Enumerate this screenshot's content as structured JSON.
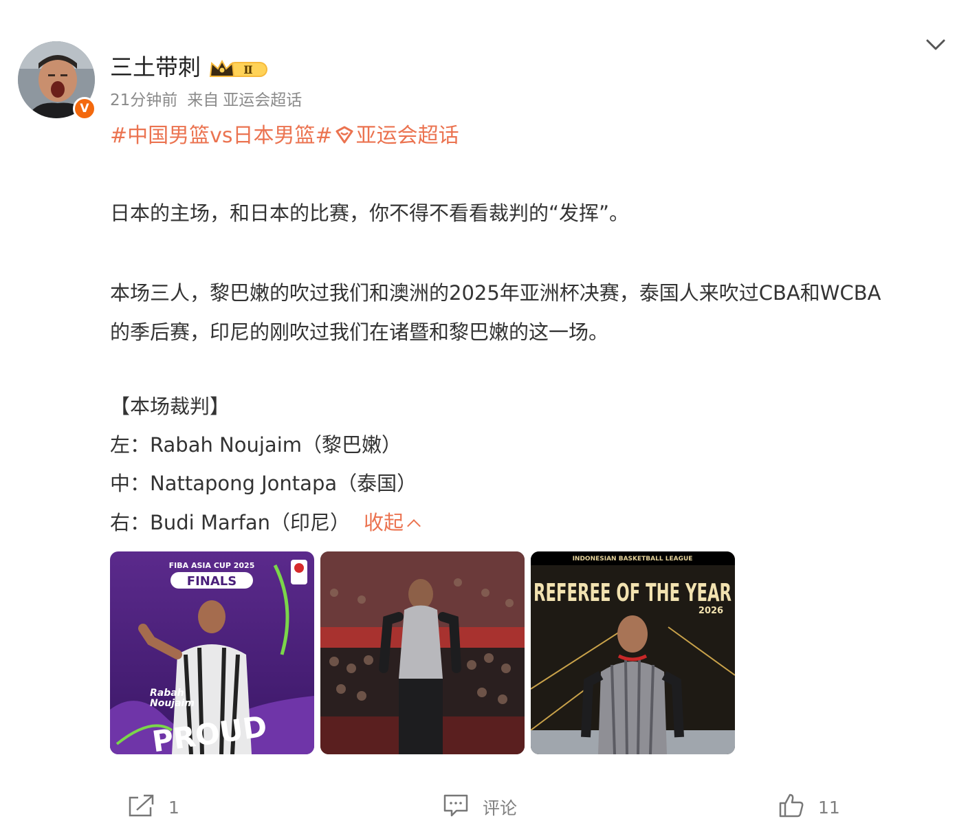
{
  "author": {
    "name": "三土带刺",
    "vip_level": "Ⅱ",
    "verified_mark": "V"
  },
  "meta": {
    "time": "21分钟前",
    "via_label": "来自",
    "source": "亚运会超话"
  },
  "tags": {
    "tag1": "#中国男篮vs日本男篮#",
    "tag2": "亚运会超话"
  },
  "content": {
    "paragraph1": "日本的主场，和日本的比赛，你不得不看看裁判的“发挥”。",
    "paragraph2_line1": "本场三人，黎巴嫩的吹过我们和澳洲的2025年亚洲杯决赛，泰国人来吹过CBA和WCBA",
    "paragraph2_line2": "的季后赛，印尼的刚吹过我们在诸暨和黎巴嫩的这一场。",
    "referee_title": "【本场裁判】",
    "referee_left": "左：Rabah Noujaim（黎巴嫩）",
    "referee_center": "中：Nattapong Jontapa（泰国）",
    "referee_right": "右：Budi Marfan（印尼）",
    "collapse_label": "收起"
  },
  "images": {
    "img1": {
      "line1": "FIBA ASIA CUP 2025",
      "line2": "FINALS",
      "line3": "Rabah",
      "line4": "Noujaim",
      "line5": "PROUD"
    },
    "img3": {
      "line1": "INDONESIAN BASKETBALL LEAGUE",
      "line2": "REFEREE OF THE YEAR",
      "line3": "2026"
    }
  },
  "actions": {
    "share_count": "1",
    "comment_label": "评论",
    "like_count": "11"
  },
  "colors": {
    "accent": "#eb7350",
    "verified": "#f3690e",
    "muted": "#808080"
  },
  "icons": [
    "chevron-down-icon",
    "crown-icon",
    "share-icon",
    "comment-icon",
    "like-icon",
    "supertopic-icon"
  ]
}
